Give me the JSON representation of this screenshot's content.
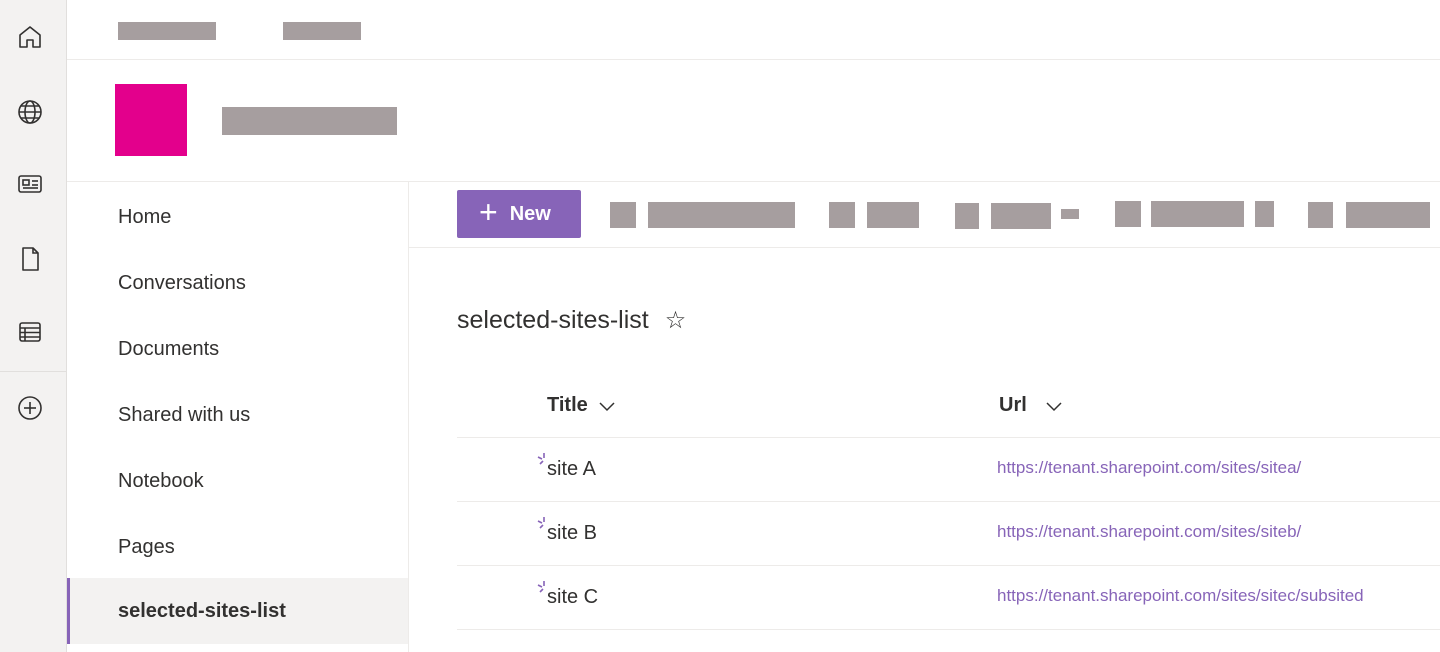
{
  "rail": {
    "icons": [
      "home-icon",
      "globe-icon",
      "news-icon",
      "file-icon",
      "list-icon",
      "add-circle-icon"
    ]
  },
  "site": {
    "logo_color": "#e3008c"
  },
  "nav": {
    "items": [
      {
        "label": "Home"
      },
      {
        "label": "Conversations"
      },
      {
        "label": "Documents"
      },
      {
        "label": "Shared with us"
      },
      {
        "label": "Notebook"
      },
      {
        "label": "Pages"
      },
      {
        "label": "selected-sites-list",
        "selected": true
      }
    ]
  },
  "cmdbar": {
    "new_label": "New",
    "accent": "#8764b8"
  },
  "list": {
    "title": "selected-sites-list",
    "columns": [
      {
        "label": "Title"
      },
      {
        "label": "Url"
      }
    ],
    "rows": [
      {
        "title": "site A",
        "url": "https://tenant.sharepoint.com/sites/sitea/"
      },
      {
        "title": "site B",
        "url": "https://tenant.sharepoint.com/sites/siteb/"
      },
      {
        "title": "site C",
        "url": "https://tenant.sharepoint.com/sites/sitec/subsited"
      }
    ]
  }
}
